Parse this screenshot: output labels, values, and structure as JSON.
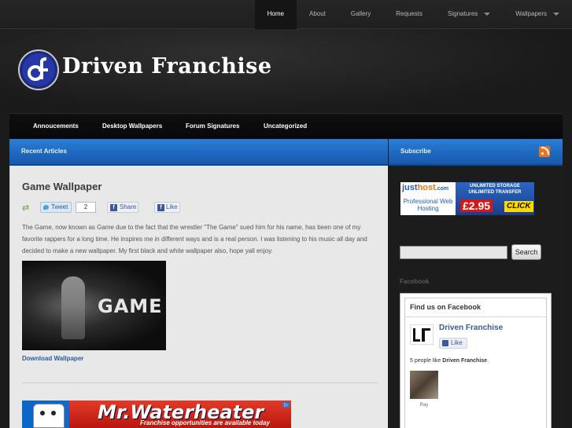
{
  "top_nav": {
    "items": [
      {
        "label": "Home",
        "active": true,
        "dropdown": false
      },
      {
        "label": "About",
        "active": false,
        "dropdown": false
      },
      {
        "label": "Gallery",
        "active": false,
        "dropdown": false
      },
      {
        "label": "Requests",
        "active": false,
        "dropdown": false
      },
      {
        "label": "Signatures",
        "active": false,
        "dropdown": true
      },
      {
        "label": "Wallpapers",
        "active": false,
        "dropdown": true
      }
    ]
  },
  "header": {
    "site_name": "Driven Franchise",
    "logo_icon": "df-logo-icon"
  },
  "category_nav": {
    "items": [
      "Annoucements",
      "Desktop Wallpapers",
      "Forum Signatures",
      "Uncategorized"
    ]
  },
  "main": {
    "section_title": "Recent Articles",
    "post": {
      "title": "Game Wallpaper",
      "share": {
        "tweet_label": "Tweet",
        "tweet_count": "2",
        "share_label": "Share",
        "like_label": "Like"
      },
      "body": "The Game, now known as Game due to the fact that the wrestler \"The Game\" sued him for his name, has been one of my favorite rappers for a long time. He inspires me in different ways and is a real person. I was listening to his music all day and decided to make a new wallpaper. My first black and white wallpaper also, hope yall enjoy.",
      "image_word": "GAME",
      "download_label": "Download Wallpaper"
    },
    "bottom_ad": {
      "brand": "Mr.Waterheater",
      "tagline": "Franchise opportunities are available today"
    }
  },
  "sidebar": {
    "section_title": "Subscribe",
    "ad": {
      "brand_main": "just",
      "brand_accent": "host",
      "brand_suffix": ".com",
      "professional": "Professional Web Hosting",
      "unlimited": "UNLIMITED STORAGE UNLIMITED TRANSFER",
      "price": "£2.95",
      "cta": "CLICK"
    },
    "search": {
      "placeholder": "",
      "button_label": "Search"
    },
    "facebook": {
      "heading": "Facebook",
      "box_title": "Find us on Facebook",
      "page_name": "Driven Franchise",
      "like_label": "Like",
      "count_text": "5 people like ",
      "count_name": "Driven Franchise",
      "count_suffix": ".",
      "fan_name": "Ray"
    }
  },
  "colors": {
    "accent_blue": "#1f6dc8",
    "facebook_blue": "#3b5998",
    "rss_orange": "#e9751f"
  }
}
